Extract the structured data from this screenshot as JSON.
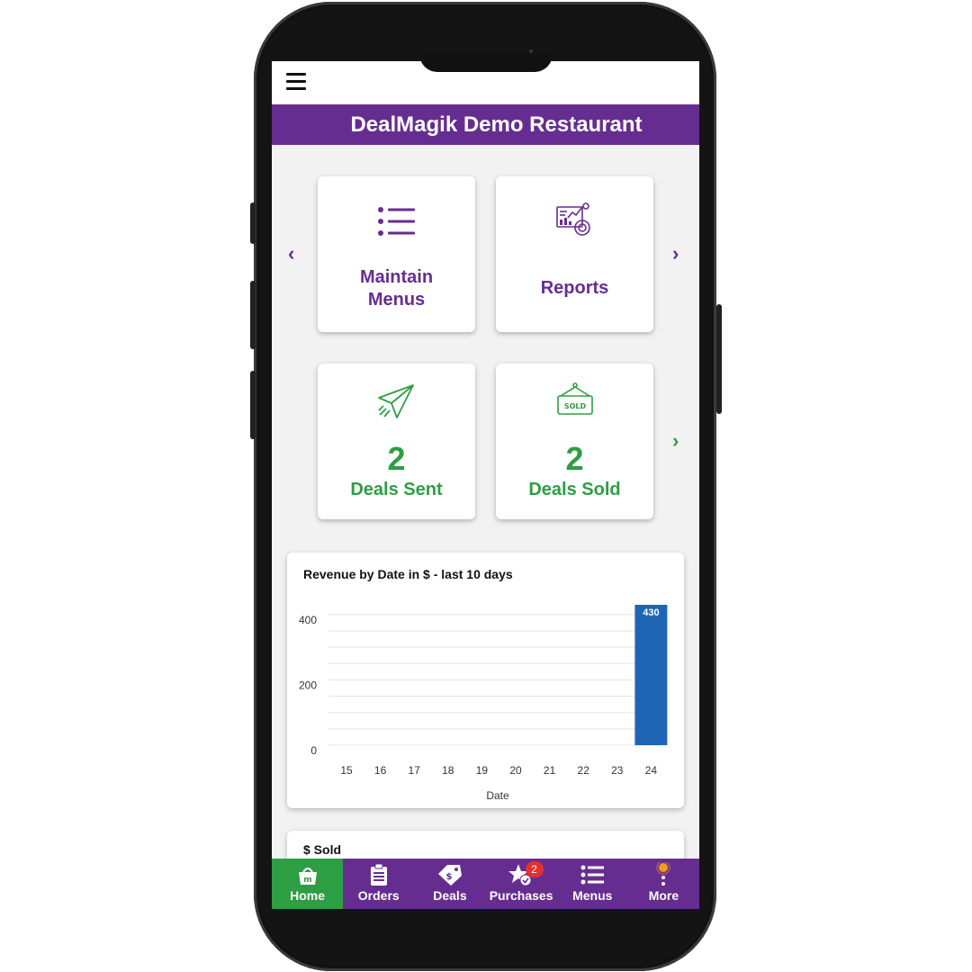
{
  "app": {
    "title": "DealMagik Demo Restaurant"
  },
  "tiles": {
    "maintain_menus": {
      "label_line1": "Maintain",
      "label_line2": "Menus",
      "icon": "list-icon"
    },
    "reports": {
      "label": "Reports",
      "icon": "report-chart-icon"
    },
    "deals_sent": {
      "value": "2",
      "label": "Deals Sent",
      "icon": "paper-plane-icon"
    },
    "deals_sold": {
      "value": "2",
      "label": "Deals Sold",
      "icon": "sold-sign-icon",
      "sign_text": "SOLD"
    }
  },
  "colors": {
    "brand_purple": "#662d91",
    "accent_green": "#2e9e44",
    "bar_blue": "#1e66b4",
    "badge_red": "#e53030"
  },
  "chart_data": {
    "type": "bar",
    "title": "Revenue by Date in $ - last 10 days",
    "xlabel": "Date",
    "ylabel": "",
    "categories": [
      "15",
      "16",
      "17",
      "18",
      "19",
      "20",
      "21",
      "22",
      "23",
      "24"
    ],
    "values": [
      0,
      0,
      0,
      0,
      0,
      0,
      0,
      0,
      0,
      430
    ],
    "data_labels": [
      "",
      "",
      "",
      "",
      "",
      "",
      "",
      "",
      "",
      "430"
    ],
    "yticks": [
      "0",
      "200",
      "400"
    ],
    "ylim": [
      0,
      430
    ],
    "grid": true
  },
  "second_card": {
    "title": "$ Sold"
  },
  "nav": {
    "items": [
      {
        "label": "Home",
        "icon": "home-logo-icon",
        "active": true
      },
      {
        "label": "Orders",
        "icon": "clipboard-icon"
      },
      {
        "label": "Deals",
        "icon": "tag-icon"
      },
      {
        "label": "Purchases",
        "icon": "star-check-icon",
        "badge": "2"
      },
      {
        "label": "Menus",
        "icon": "list-icon"
      },
      {
        "label": "More",
        "icon": "more-icon"
      }
    ]
  }
}
